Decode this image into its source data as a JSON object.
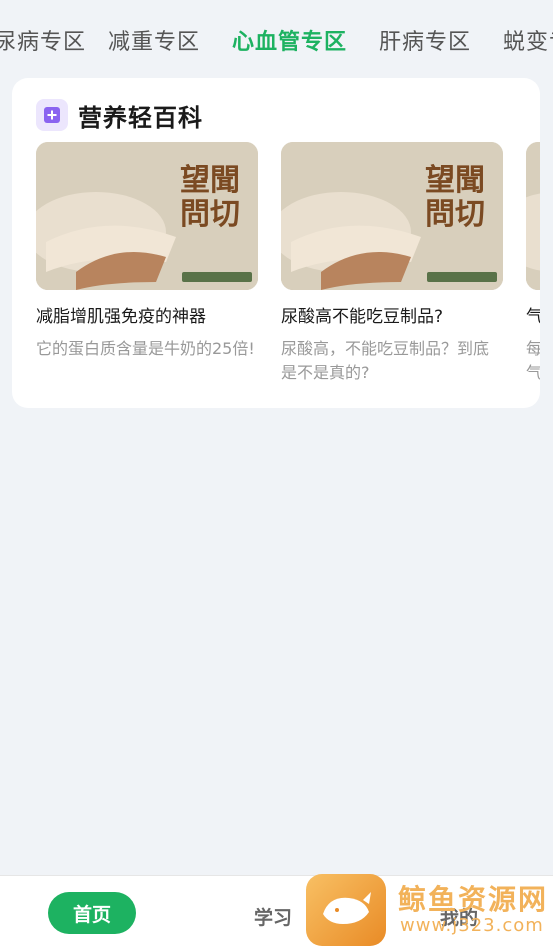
{
  "tabs": [
    {
      "label": "尿病专区",
      "active": false
    },
    {
      "label": "减重专区",
      "active": false
    },
    {
      "label": "心血管专区",
      "active": true
    },
    {
      "label": "肝病专区",
      "active": false
    },
    {
      "label": "蜕变专区",
      "active": false
    }
  ],
  "card": {
    "title": "营养轻百科",
    "icon": "plus-square-icon",
    "items": [
      {
        "title": "减脂增肌强免疫的神器",
        "desc": "它的蛋白质含量是牛奶的25倍!",
        "image": {
          "big_text": [
            "望聞",
            "問切"
          ]
        }
      },
      {
        "title": "尿酸高不能吃豆制品?",
        "desc": "尿酸高，不能吃豆制品？到底是不是真的?",
        "image": {
          "big_text": [
            "望聞",
            "問切"
          ]
        }
      },
      {
        "title": "气",
        "desc": "每气",
        "image": {
          "big_text": [
            "",
            ""
          ]
        }
      }
    ]
  },
  "bottom_nav": {
    "home": "首页",
    "study": "学习",
    "mine": "我的"
  },
  "watermark": {
    "name": "鲸鱼资源网",
    "url": "www.j323.com"
  },
  "colors": {
    "accent": "#1db261",
    "background": "#f0f3f7"
  }
}
